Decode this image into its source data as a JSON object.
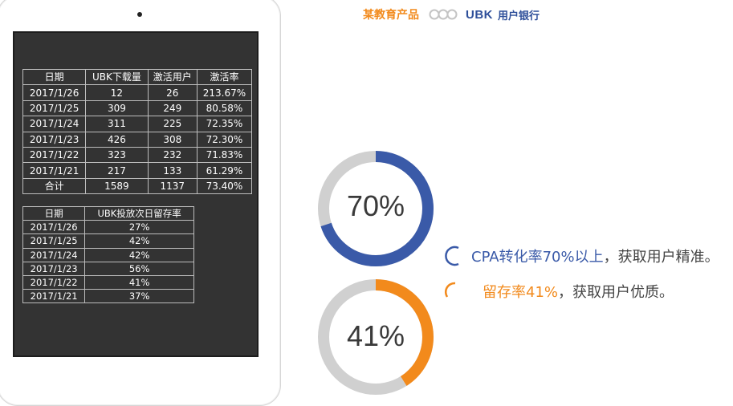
{
  "header": {
    "brand_left": "某教育产品",
    "brand_ubk": "UBK",
    "brand_right": "用户银行"
  },
  "colors": {
    "blue": "#3a5aa8",
    "orange": "#f28a1c",
    "gray_ring": "#d0d0d0",
    "screen": "#333333"
  },
  "table1": {
    "headers": [
      "日期",
      "UBK下载量",
      "激活用户",
      "激活率"
    ],
    "rows": [
      [
        "2017/1/26",
        "12",
        "26",
        "213.67%"
      ],
      [
        "2017/1/25",
        "309",
        "249",
        "80.58%"
      ],
      [
        "2017/1/24",
        "311",
        "225",
        "72.35%"
      ],
      [
        "2017/1/23",
        "426",
        "308",
        "72.30%"
      ],
      [
        "2017/1/22",
        "323",
        "232",
        "71.83%"
      ],
      [
        "2017/1/21",
        "217",
        "133",
        "61.29%"
      ],
      [
        "合计",
        "1589",
        "1137",
        "73.40%"
      ]
    ]
  },
  "table2": {
    "headers": [
      "日期",
      "UBK投放次日留存率"
    ],
    "rows": [
      [
        "2017/1/26",
        "27%"
      ],
      [
        "2017/1/25",
        "42%"
      ],
      [
        "2017/1/24",
        "42%"
      ],
      [
        "2017/1/23",
        "56%"
      ],
      [
        "2017/1/22",
        "41%"
      ],
      [
        "2017/1/21",
        "37%"
      ]
    ]
  },
  "donuts": [
    {
      "label": "70%",
      "fraction": 0.7,
      "color": "#3a5aa8"
    },
    {
      "label": "41%",
      "fraction": 0.41,
      "color": "#f28a1c"
    }
  ],
  "captions": [
    {
      "highlight": "CPA转化率70%以上",
      "rest": "，获取用户精准。"
    },
    {
      "highlight": "留存率41%",
      "rest": "，获取用户优质。"
    }
  ]
}
